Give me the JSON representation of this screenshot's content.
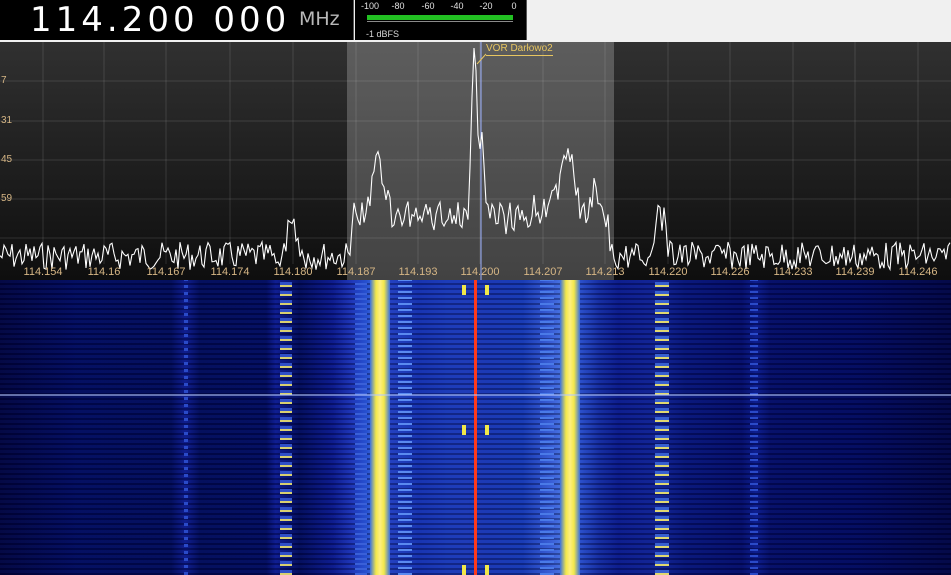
{
  "frequency": {
    "digits": "114.200 000",
    "unit": "MHz"
  },
  "smeter": {
    "ticks": [
      "-100",
      "-80",
      "-60",
      "-40",
      "-20",
      "0"
    ],
    "readout": "-1 dBFS",
    "bar_color": "#22c022"
  },
  "spectrum": {
    "db_labels": [
      "7",
      "31",
      "45",
      "59"
    ],
    "freq_labels": [
      "114.154",
      "114.16",
      "114.167",
      "114.174",
      "114.180",
      "114.187",
      "114.193",
      "114.200",
      "114.207",
      "114.213",
      "114.220",
      "114.226",
      "114.233",
      "114.239",
      "114.246"
    ],
    "bookmark": "VOR Darłowo2",
    "trace_color": "#ffffff",
    "label_color": "#d6b685"
  },
  "waterfall": {
    "colors": {
      "background": "#000a5a",
      "peak": "#f2e84a",
      "edge": "#5080e8",
      "marker": "#ff3a1a"
    }
  }
}
